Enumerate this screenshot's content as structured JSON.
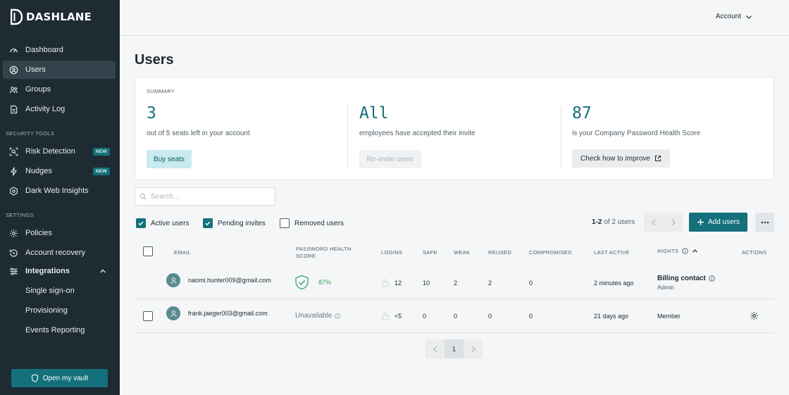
{
  "app": {
    "logo_text": "DASHLANE"
  },
  "sidebar": {
    "items": [
      {
        "label": "Dashboard",
        "icon": "dashboard-icon"
      },
      {
        "label": "Users",
        "icon": "users-icon",
        "active": true
      },
      {
        "label": "Groups",
        "icon": "groups-icon"
      },
      {
        "label": "Activity Log",
        "icon": "activity-log-icon"
      }
    ],
    "security_tools_label": "SECURITY TOOLS",
    "security_items": [
      {
        "label": "Risk Detection",
        "icon": "risk-detection-icon",
        "badge": "NEW"
      },
      {
        "label": "Nudges",
        "icon": "nudges-icon",
        "badge": "NEW"
      },
      {
        "label": "Dark Web Insights",
        "icon": "dark-web-icon"
      }
    ],
    "settings_label": "SETTINGS",
    "settings_items": [
      {
        "label": "Policies",
        "icon": "policies-icon"
      },
      {
        "label": "Account recovery",
        "icon": "account-recovery-icon"
      },
      {
        "label": "Integrations",
        "icon": "integrations-icon",
        "expanded": true
      }
    ],
    "integration_subitems": [
      "Single sign-on",
      "Provisioning",
      "Events Reporting"
    ],
    "vault_button": "Open my vault"
  },
  "header": {
    "account_label": "Account"
  },
  "page": {
    "title": "Users"
  },
  "summary": {
    "label": "SUMMARY",
    "seats": {
      "value": "3",
      "desc": "out of 5 seats left in your account",
      "button": "Buy seats"
    },
    "invites": {
      "value": "All",
      "desc": "employees have accepted their invite",
      "button": "Re-invite users"
    },
    "health": {
      "value": "87",
      "desc": "is your Company Password Health Score",
      "button": "Check how to improve"
    }
  },
  "search": {
    "placeholder": "Search..."
  },
  "filters": [
    {
      "label": "Active users",
      "checked": true
    },
    {
      "label": "Pending invites",
      "checked": true
    },
    {
      "label": "Removed users",
      "checked": false
    }
  ],
  "paging": {
    "range": "1-2",
    "suffix": "of 2 users",
    "page": "1"
  },
  "add_users_label": "Add users",
  "table": {
    "headers": {
      "email": "EMAIL",
      "health": "PASSWORD HEALTH SCORE",
      "logins": "LOGINS",
      "safe": "SAFE",
      "weak": "WEAK",
      "reused": "REUSED",
      "compromised": "COMPROMISED",
      "last_active": "LAST ACTIVE",
      "rights": "RIGHTS",
      "actions": "ACTIONS"
    },
    "rows": [
      {
        "email": "naomi.hunter009@gmail.com",
        "health": "87%",
        "logins": "12",
        "safe": "10",
        "weak": "2",
        "reused": "2",
        "compromised": "0",
        "last_active": "2 minutes ago",
        "rights": "Billing contact",
        "rights_sub": "Admin"
      },
      {
        "email": "frank.jaeger003@gmail.com",
        "health": "Unavailable",
        "logins": "<5",
        "safe": "0",
        "weak": "0",
        "reused": "0",
        "compromised": "0",
        "last_active": "21 days ago",
        "rights": "Member"
      }
    ]
  },
  "colors": {
    "accent": "#14707a",
    "sidebar_bg": "#1e2b33",
    "health_good": "#2e9e5b"
  }
}
